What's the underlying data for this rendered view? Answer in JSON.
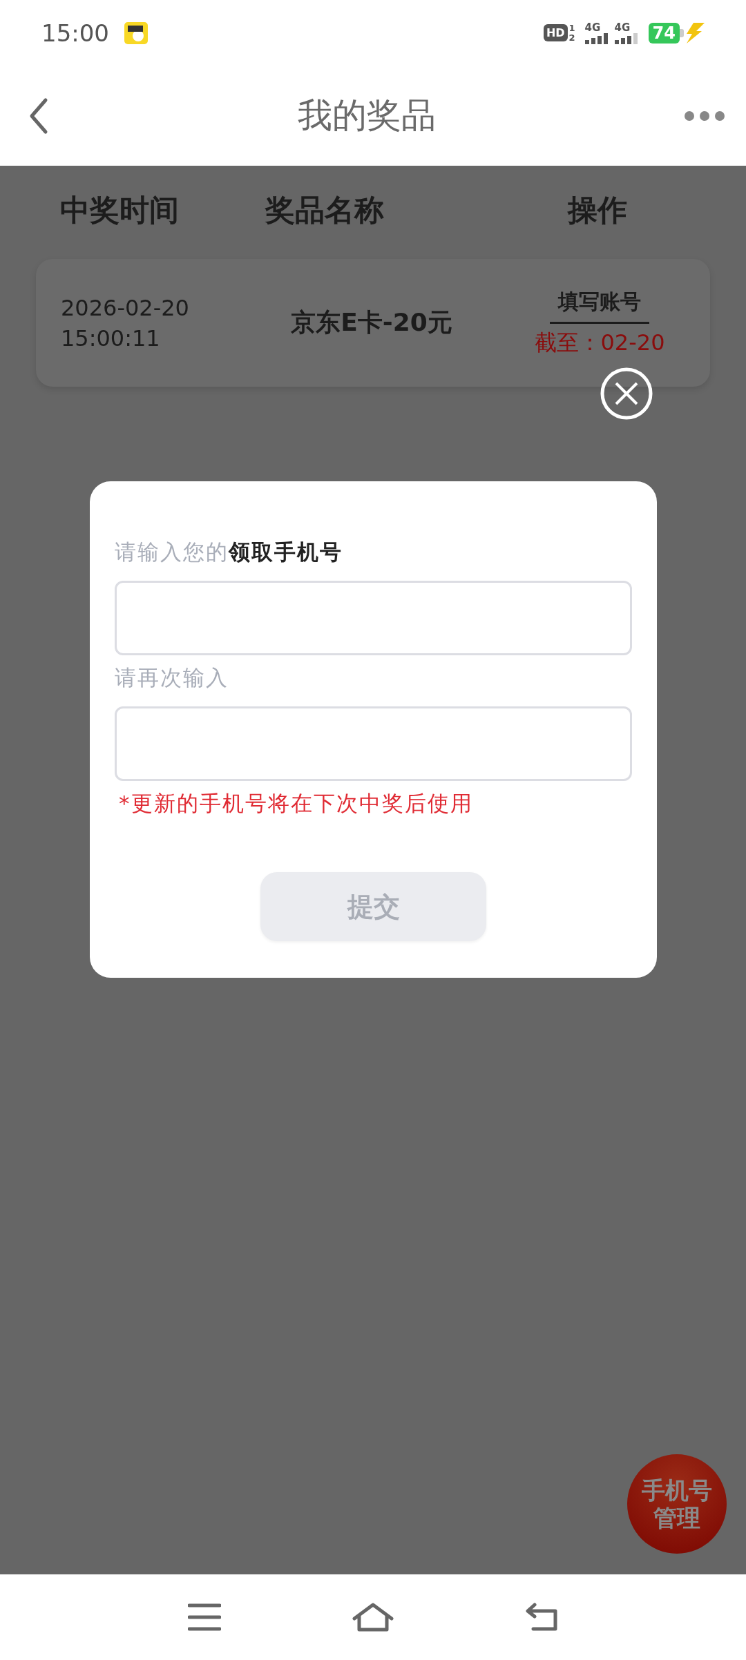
{
  "status_bar": {
    "time": "15:00",
    "hd": {
      "label": "HD",
      "sims": [
        "1",
        "2"
      ]
    },
    "networks": [
      "4G",
      "4G"
    ],
    "battery": "74"
  },
  "header": {
    "title": "我的奖品"
  },
  "table": {
    "columns": [
      "中奖时间",
      "奖品名称",
      "操作"
    ],
    "rows": [
      {
        "date": "2026-02-20",
        "time": "15:00:11",
        "prize": "京东E卡-20元",
        "action": "填写账号",
        "deadline": "截至：02-20"
      }
    ]
  },
  "dialog": {
    "label_1": "请输入您的**领取手机号**",
    "label_2": "请再次输入",
    "note": "*更新的手机号将在下次中奖后使用",
    "submit": {
      "label": "提交",
      "disabled": true
    }
  },
  "floating_button": {
    "lines": [
      "手机号",
      "管理"
    ]
  }
}
